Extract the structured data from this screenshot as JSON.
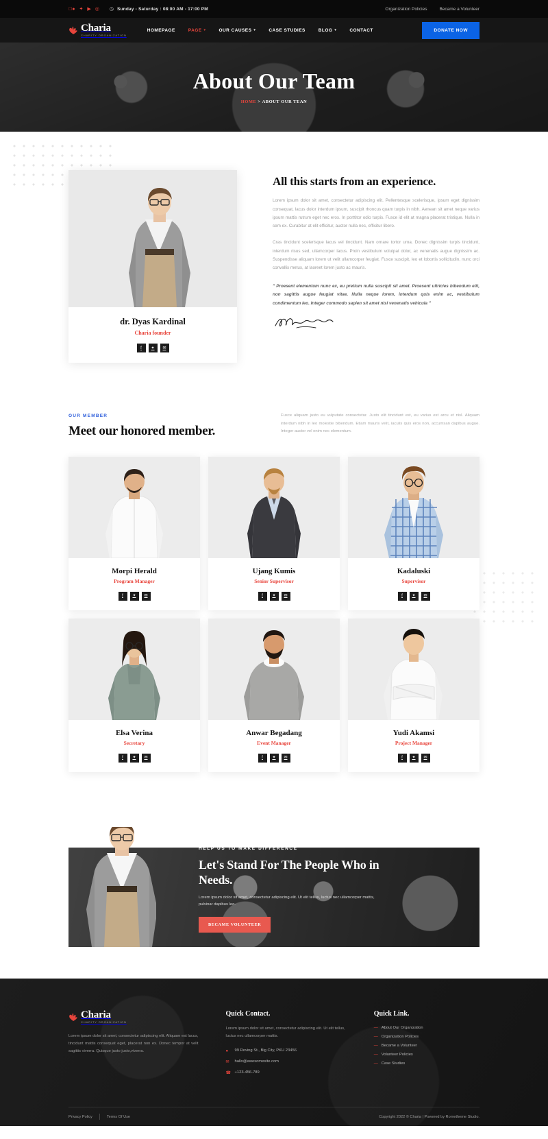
{
  "topbar": {
    "socials": [
      "facebook-icon",
      "twitter-icon",
      "youtube-icon",
      "instagram-icon"
    ],
    "hours": "Sunday - Saturday : 08:00 AM - 17:00 PM",
    "links": [
      "Organization Policies",
      "Became a Volunteer"
    ]
  },
  "nav": {
    "brand_name": "Charia",
    "brand_sub": "Charity Organization",
    "menu": [
      {
        "label": "HOMEPAGE",
        "caret": false,
        "active": false
      },
      {
        "label": "PAGE",
        "caret": true,
        "active": true
      },
      {
        "label": "OUR CAUSES",
        "caret": true,
        "active": false
      },
      {
        "label": "CASE STUDIES",
        "caret": false,
        "active": false
      },
      {
        "label": "BLOG",
        "caret": true,
        "active": false
      },
      {
        "label": "CONTACT",
        "caret": false,
        "active": false
      }
    ],
    "donate_label": "DONATE NOW",
    "donate_color": "#0b63e5"
  },
  "hero": {
    "title": "About Our Team",
    "crumb_home": "HOME",
    "crumb_sep": ">",
    "crumb_current": "ABOUT OUR TEAN"
  },
  "intro": {
    "heading": "All this starts from an experience.",
    "paragraph1": "Lorem ipsum dolor sit amet, consectetur adipiscing elit. Pellentesque scelerisque, ipsum eget dignissim consequat, lacus dolor interdum ipsum, suscipit rhoncus quam turpis in nibh. Aenean sit amet neque varius ipsum mattis rutrum eget nec eros. In porttitor odio turpis. Fusce id elit at magna placerat tristique. Nulla in sem ex. Curabitur at elit efficitur, auctor nulla nec, efficitur libero.",
    "paragraph2": "Cras tincidunt scelerisque lacus vel tincidunt. Nam ornare tortor urna. Donec dignissim turpis tincidunt, interdum risus sed, ullamcorper lacus. Proin vestibulum volutpat dolor, ac venenatis augue dignissim ac. Suspendisse aliquam lorem ut velit ullamcorper feugiat. Fusce suscipit, leo et lobortis sollicitudin, nunc orci convallis metus, at laoreet lorem justo ac mauris.",
    "quote": "” Proesent elementum nunc ex, eu pretium nulla suscipit sit amet. Proesent ultricies bibendum elit, non sagittis augue feugiat vitae. Nulla neque lorem, interdum quis enim ac, vestibulum condimentum leo. Integer commodo sapien sit amet nisl venenatis vehicula ”",
    "signature": "Dyas Kardinal"
  },
  "founder": {
    "name": "dr. Dyas Kardinal",
    "role": "Charia founder",
    "socials": [
      "facebook-icon",
      "twitter-icon",
      "email-icon"
    ]
  },
  "members_section": {
    "eyebrow": "OUR MEMBER",
    "eyebrow_color": "#2b5cdb",
    "title": "Meet our honored member.",
    "description": "Fusce aliquam justo eu vulputate consectetur. Justo elit tincidunt est, eu varius est arcu et nisl. Aliquam interdum nibh in leo molestie bibendum. Etiam mauris velit, iaculis quis eros non, accumsan dapibus augue. Integer auctor vel enim nec elementum.",
    "members": [
      {
        "name": "Morpi Herald",
        "role": "Program Manager"
      },
      {
        "name": "Ujang Kumis",
        "role": "Senior Supervisor"
      },
      {
        "name": "Kadaluski",
        "role": "Supervisor"
      },
      {
        "name": "Elsa Verina",
        "role": "Secretary"
      },
      {
        "name": "Anwar Begadang",
        "role": "Event Manager"
      },
      {
        "name": "Yudi Akamsi",
        "role": "Project Manager"
      }
    ],
    "card_socials": [
      "facebook-icon",
      "twitter-icon",
      "email-icon"
    ]
  },
  "cta": {
    "eyebrow": "HELP US TO MAKE DIFFERENCE",
    "title": "Let's Stand For The People Who in Needs.",
    "paragraph": "Lorem ipsum dolor sit amet, consectetur adipiscing elit. Ut elit tellus, luctus nec ullamcorper mattis, pulvinar dapibus leo.",
    "button_label": "BECAME VOLUNTEER",
    "button_color": "#e8594f"
  },
  "footer": {
    "brand_name": "Charia",
    "brand_sub": "Charity Organization",
    "about": "Lorem ipsum dolor sit amet, consectetur adipiscing elit. Aliquam est lacus, tincidunt mattis consequat eget, placerat non ex. Donec tempor at velit sagittis viverra. Quisque justo justo,viverra.",
    "contact_title": "Quick Contact.",
    "contact_sub": "Lorem ipsum dolor sit amet, consectetur adipiscing elit. Ut elit tellus, luctus nec ullamcorper mattis.",
    "contact_items": [
      {
        "icon": "location-pin-icon",
        "text": "99 Roving St., Big City, PKU 23456"
      },
      {
        "icon": "envelope-icon",
        "text": "hallo@awesomesite.com"
      },
      {
        "icon": "phone-icon",
        "text": "+123-456-789"
      }
    ],
    "links_title": "Quick Link.",
    "links": [
      "About Our Organization",
      "Organization Policies",
      "Became a Volunteer",
      "Volunteer Policies",
      "Case Studies"
    ],
    "bottom_links": [
      "Privacy Policy",
      "Terms Of Use"
    ],
    "copyright": "Copyright 2022 © Charia | Powered by Rometheme Studio."
  }
}
